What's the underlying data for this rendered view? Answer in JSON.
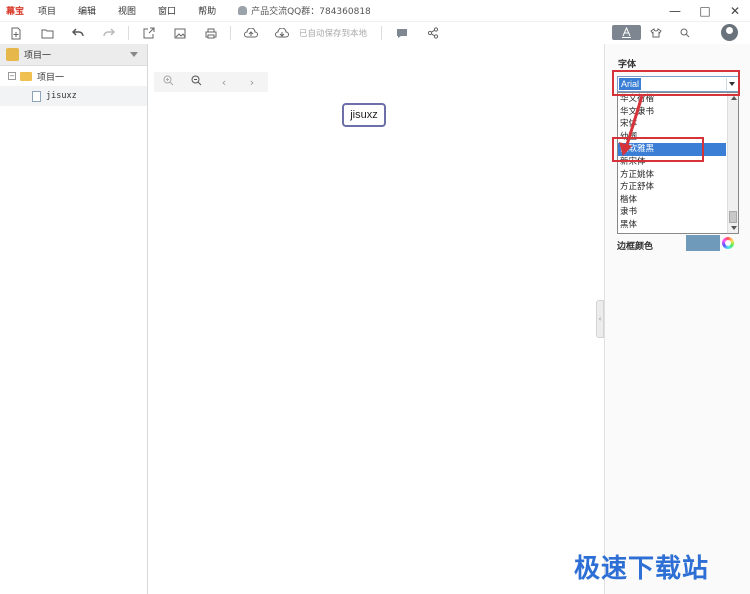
{
  "app": {
    "name": "幕宝"
  },
  "menu": [
    "项目",
    "编辑",
    "视图",
    "窗口",
    "帮助"
  ],
  "qq_group_text": "产品交流QQ群：784360818",
  "toolbar": {
    "icons": [
      "new-file-icon",
      "open-folder-icon",
      "undo-icon",
      "redo-icon",
      "export-icon",
      "image-icon",
      "print-icon",
      "upload-cloud-icon",
      "download-cloud-icon",
      "comment-icon",
      "share-icon"
    ],
    "autosave_label": "已自动保存到本地",
    "right_tabs": [
      "text-style-icon",
      "theme-icon",
      "search-icon"
    ]
  },
  "project_panel": {
    "header": "项目一",
    "tree": {
      "root": "项目一",
      "child": "jisuxz"
    }
  },
  "canvas": {
    "zoom_controls": [
      "zoom-in-icon",
      "zoom-out-icon",
      "prev-icon",
      "next-icon"
    ],
    "node_label": "jisuxz"
  },
  "properties": {
    "font_label": "字体",
    "font_value": "Arial",
    "font_options": [
      "华文行楷",
      "华文隶书",
      "宋体",
      "幼圆",
      "微软雅黑",
      "新宋体",
      "方正姚体",
      "方正舒体",
      "楷体",
      "隶书",
      "黑体"
    ],
    "selected_option": "微软雅黑",
    "border_color_label": "边框颜色",
    "border_color": "#6f9ab9"
  },
  "watermark": "极速下载站",
  "colors": {
    "highlight": "#d6323a",
    "selection": "#3a7fd5",
    "watermark": "#2d6fd4"
  }
}
